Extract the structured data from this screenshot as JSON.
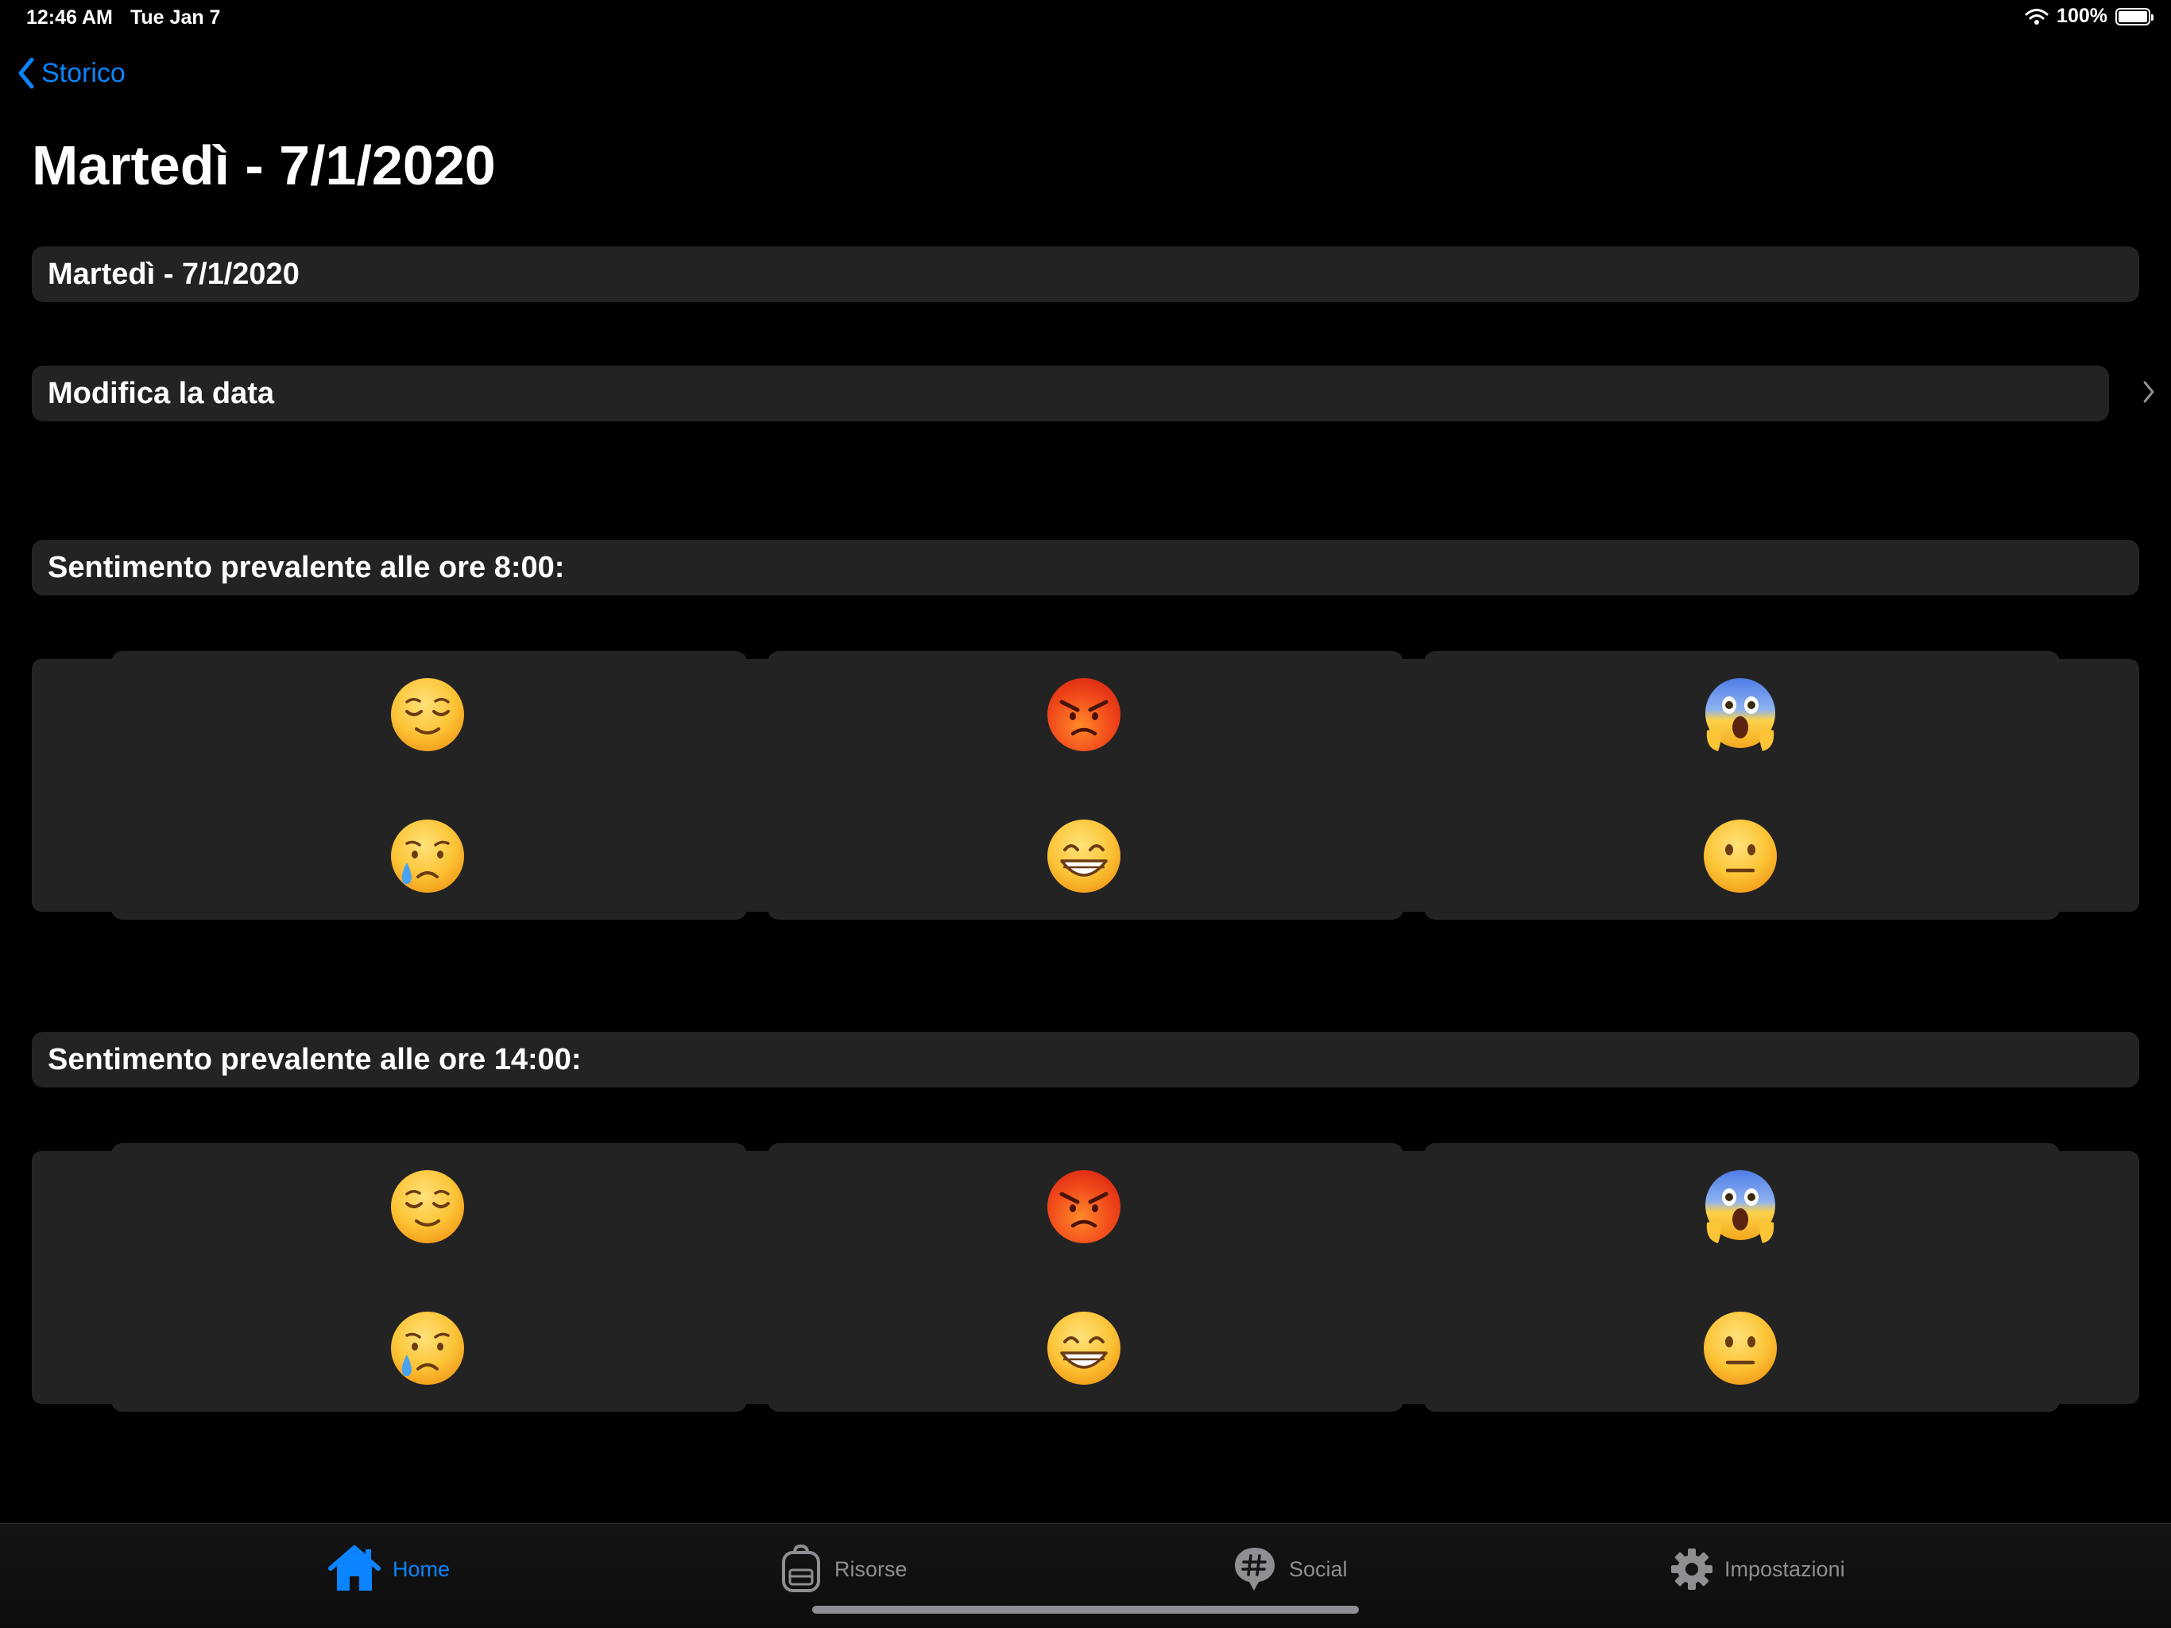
{
  "status_bar": {
    "time": "12:46 AM",
    "date": "Tue Jan 7",
    "battery_percent": "100%",
    "battery_level": 1.0,
    "icons": [
      "wifi-icon",
      "battery-icon"
    ]
  },
  "nav": {
    "back_label": "Storico",
    "title": "Martedì - 7/1/2020"
  },
  "date_row": {
    "label": "Martedì - 7/1/2020"
  },
  "edit_date_row": {
    "label": "Modifica la data"
  },
  "sections": [
    {
      "header": "Sentimento prevalente alle ore 8:00:",
      "emojis": [
        "relieved",
        "angry",
        "screaming",
        "crying",
        "grinning",
        "neutral"
      ]
    },
    {
      "header": "Sentimento prevalente alle ore 14:00:",
      "emojis": [
        "relieved",
        "angry",
        "screaming",
        "crying",
        "grinning",
        "neutral"
      ]
    }
  ],
  "tab_bar": {
    "tabs": [
      {
        "label": "Home",
        "icon": "house-icon",
        "active": true
      },
      {
        "label": "Risorse",
        "icon": "backpack-icon",
        "active": false
      },
      {
        "label": "Social",
        "icon": "hashtag-bubble-icon",
        "active": false
      },
      {
        "label": "Impostazioni",
        "icon": "gear-icon",
        "active": false
      }
    ]
  },
  "colors": {
    "accent": "#0a84ff",
    "background": "#000000",
    "row_background": "#232323",
    "inactive": "#8e8e93"
  }
}
